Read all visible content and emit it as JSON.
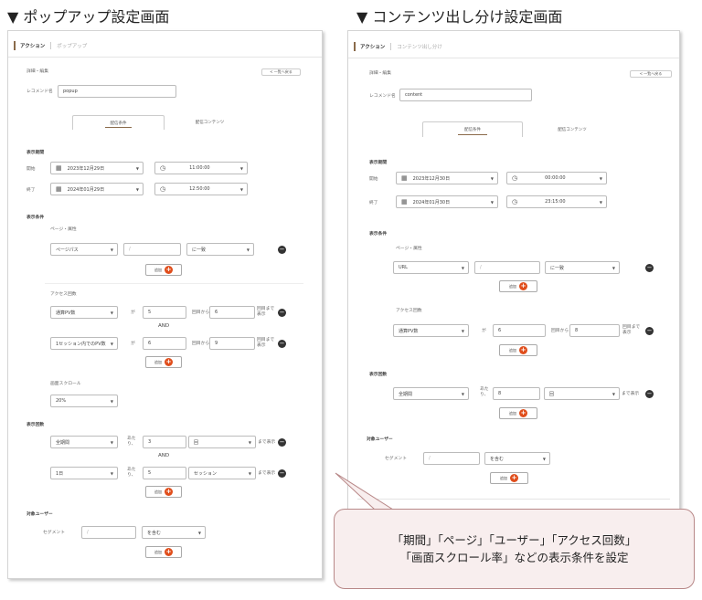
{
  "headings": {
    "left": "▼ ポップアップ設定画面",
    "right": "▼ コンテンツ出し分け設定画面"
  },
  "left": {
    "breadcrumb": {
      "current": "アクション",
      "sub": "ポップアップ"
    },
    "edit_title": "詳細・編集",
    "back_label": "< 一覧へ戻る",
    "name_label": "レコメンド名",
    "name_value": "popup",
    "tabs": [
      "配信条件",
      "配信コンテンツ"
    ],
    "period": {
      "title": "表示期間",
      "start_label": "開始",
      "start_date": "2023年12月29日",
      "start_time": "11:00:00",
      "end_label": "終了",
      "end_date": "2024年01月29日",
      "end_time": "12:50:00"
    },
    "conditions": {
      "title": "表示条件",
      "page_attr_label": "ページ・属性",
      "page_type": "ページパス",
      "page_value": "/",
      "page_match": "に一致",
      "add_label": "追加",
      "access_label": "アクセス回数",
      "row1": {
        "metric": "通算PV数",
        "ga": "が",
        "value": "5",
        "from_label": "回目から",
        "to_value": "6",
        "unit": "回目まで表示"
      },
      "and_label": "AND",
      "row2": {
        "metric": "1セッション内でのPV数",
        "ga": "が",
        "value": "6",
        "from_label": "回目から",
        "to_value": "9",
        "unit": "回目まで表示"
      },
      "scroll_label": "画面スクロール",
      "scroll_value": "20%"
    },
    "display_count": {
      "title": "表示回数",
      "row1": {
        "period": "全期間",
        "per": "あたり、",
        "value": "3",
        "unit": "回",
        "suffix": "まで表示"
      },
      "and_label": "AND",
      "row2": {
        "period": "1日",
        "per": "あたり、",
        "value": "5",
        "unit": "セッション",
        "suffix": "まで表示"
      }
    },
    "target": {
      "title": "対象ユーザー",
      "segment_label": "セグメント",
      "segment_value": "/",
      "match": "を含む"
    }
  },
  "right": {
    "breadcrumb": {
      "current": "アクション",
      "sub": "コンテンツ出し分け"
    },
    "edit_title": "詳細・編集",
    "back_label": "< 一覧へ戻る",
    "name_label": "レコメンド名",
    "name_value": "content",
    "tabs": [
      "配信条件",
      "配信コンテンツ"
    ],
    "period": {
      "title": "表示期間",
      "start_label": "開始",
      "start_date": "2023年12月30日",
      "start_time": "00:00:00",
      "end_label": "終了",
      "end_date": "2024年01月30日",
      "end_time": "23:15:00"
    },
    "conditions": {
      "title": "表示条件",
      "page_attr_label": "ページ・属性",
      "page_type": "URL",
      "page_value": "/",
      "page_match": "に一致",
      "add_label": "追加",
      "access_label": "アクセス回数",
      "row1": {
        "metric": "通算PV数",
        "ga": "が",
        "value": "6",
        "from_label": "回目から",
        "to_value": "8",
        "unit": "回目まで表示"
      }
    },
    "display_count": {
      "title": "表示回数",
      "row1": {
        "period": "全期間",
        "per": "あたり、",
        "value": "8",
        "unit": "回",
        "suffix": "まで表示"
      }
    },
    "target": {
      "title": "対象ユーザー",
      "segment_label": "セグメント",
      "segment_value": "/",
      "match": "を含む"
    }
  },
  "callout": {
    "line1": "「期間」「ページ」「ユーザー」「アクセス回数」",
    "line2": "「画面スクロール率」などの表示条件を設定"
  },
  "icons": {
    "calendar": "calendar-icon",
    "clock": "clock-icon",
    "add": "plus-icon",
    "remove": "minus-icon"
  },
  "colors": {
    "accent": "#8a6a4a",
    "add": "#e04e1c",
    "callout_bg": "#f8eeee",
    "callout_border": "#b88888"
  }
}
